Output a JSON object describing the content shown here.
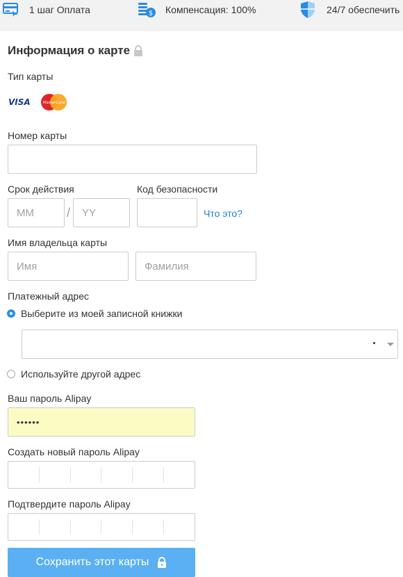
{
  "topbar": {
    "items": [
      {
        "icon": "card-icon",
        "label": "1 шаг Оплата"
      },
      {
        "icon": "coins-icon",
        "label": "Компенсация: 100%"
      },
      {
        "icon": "shield-icon",
        "label": "24/7 обеспечить"
      }
    ]
  },
  "form": {
    "title": "Информация о карте",
    "card_type_label": "Тип карты",
    "card_brands": [
      {
        "name": "VISA",
        "icon": "visa-icon"
      },
      {
        "name": "MasterCard",
        "icon": "mastercard-icon"
      }
    ],
    "card_number_label": "Номер карты",
    "card_number_value": "",
    "expiry_label": "Срок действия",
    "expiry_month_placeholder": "MM",
    "expiry_year_placeholder": "YY",
    "security_code_label": "Код безопасности",
    "security_code_value": "",
    "whats_this_link": "Что это?",
    "holder_label": "Имя владельца карты",
    "first_name_placeholder": "Имя",
    "last_name_placeholder": "Фамилия",
    "billing_label": "Платежный адрес",
    "billing_options": [
      {
        "label": "Выберите из моей записной книжки",
        "selected": true
      },
      {
        "label": "Используйте другой адрес",
        "selected": false
      }
    ],
    "address_select_value": "",
    "alipay_password_label": "Ваш пароль Alipay",
    "alipay_password_value": "••••••",
    "new_password_label": "Создать новый пароль Alipay",
    "confirm_password_label": "Подтвердите пароль Alipay",
    "save_button_label": "Сохранить этот карты"
  },
  "colors": {
    "accent": "#1e7fd7",
    "button_bg": "#5ab0f2",
    "autofill_bg": "#fafcc4",
    "radio_on": "#2d8ff0"
  }
}
